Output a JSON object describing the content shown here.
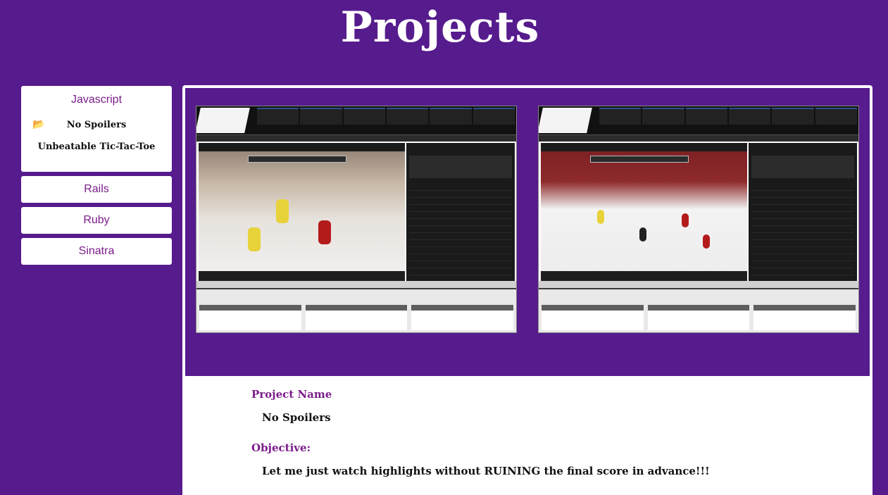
{
  "header": {
    "title": "Projects"
  },
  "sidebar": {
    "categories": [
      {
        "label": "Javascript",
        "expanded": true,
        "projects": [
          {
            "label": "No Spoilers",
            "icon": "folder-open-icon",
            "selected": true
          },
          {
            "label": "Unbeatable Tic-Tac-Toe"
          }
        ]
      },
      {
        "label": "Rails"
      },
      {
        "label": "Ruby"
      },
      {
        "label": "Sinatra"
      }
    ]
  },
  "project": {
    "name_label": "Project Name",
    "name": "No Spoilers",
    "objective_label": "Objective:",
    "objective": "Let me just watch highlights without RUINING the final score in advance!!!"
  },
  "colors": {
    "background": "#561b8d",
    "accent": "#7a1d8a",
    "card": "#ffffff"
  }
}
